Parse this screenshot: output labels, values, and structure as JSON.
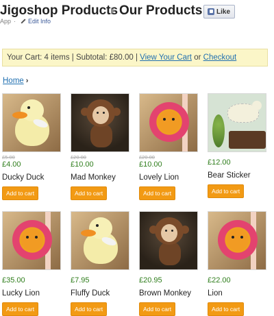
{
  "header": {
    "app_title": "Jigoshop Products",
    "page_title": "Our Products",
    "like_label": "Like",
    "subline_app": "App",
    "subline_sep": "·",
    "edit_info": "Edit Info"
  },
  "cart": {
    "summary": "Your Cart: 4 items | Subtotal: £80.00 |",
    "view_cart": "View Your Cart",
    "or": "or",
    "checkout": "Checkout"
  },
  "breadcrumb": {
    "home": "Home",
    "arrow": "›"
  },
  "products": [
    {
      "name": "Ducky Duck",
      "old_price": "£5.00",
      "price": "£4.00",
      "button": "Add to cart",
      "photo": "duck"
    },
    {
      "name": "Mad Monkey",
      "old_price": "£20.00",
      "price": "£10.00",
      "button": "Add to cart",
      "photo": "monkey"
    },
    {
      "name": "Lovely Lion",
      "old_price": "£20.00",
      "price": "£10.00",
      "button": "Add to cart",
      "photo": "lion"
    },
    {
      "name": "Bear Sticker",
      "old_price": "",
      "price": "£12.00",
      "button": "Add to cart",
      "photo": "bear"
    },
    {
      "name": "Lucky Lion",
      "old_price": "",
      "price": "£35.00",
      "button": "Add to cart",
      "photo": "lion"
    },
    {
      "name": "Fluffy Duck",
      "old_price": "",
      "price": "£7.95",
      "button": "Add to cart",
      "photo": "duck"
    },
    {
      "name": "Brown Monkey",
      "old_price": "",
      "price": "£20.95",
      "button": "Add to cart",
      "photo": "monkey"
    },
    {
      "name": "Lion",
      "old_price": "",
      "price": "£22.00",
      "button": "Add to cart",
      "photo": "lion"
    }
  ],
  "colors": {
    "price_green": "#2e7d1b",
    "button_orange": "#f29a14",
    "cart_bar_bg": "#fbf6c8",
    "link_blue": "#1f6fb0"
  }
}
